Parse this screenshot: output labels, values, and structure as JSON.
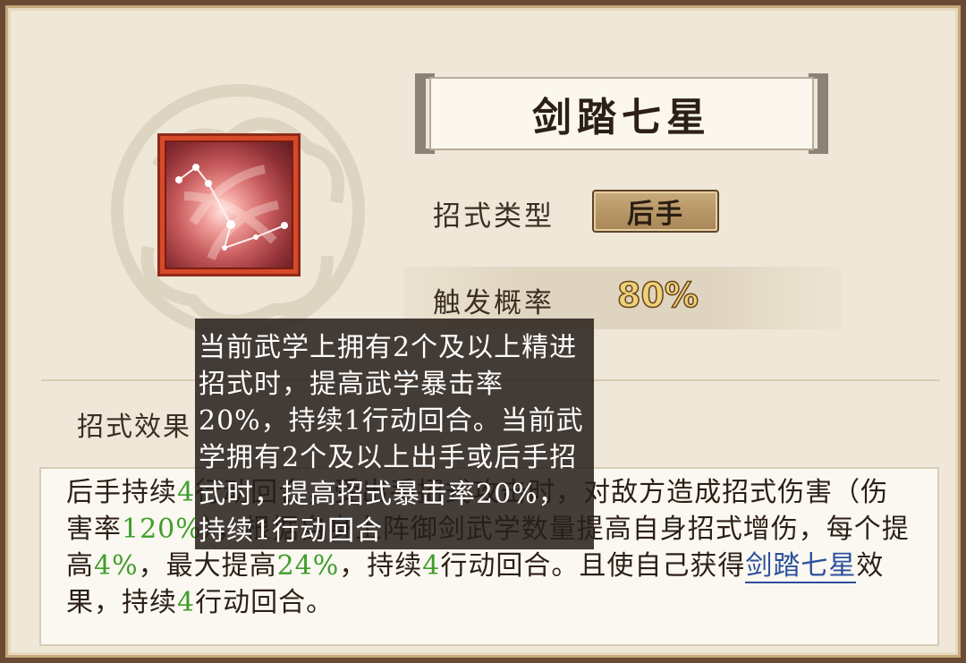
{
  "skill": {
    "name": "剑踏七星",
    "icon": "constellation-skill-icon"
  },
  "attributes": {
    "type_label": "招式类型",
    "type_value": "后手",
    "rate_label": "触发概率",
    "rate_value": "80%"
  },
  "effect": {
    "label": "招式效果",
    "text_parts": [
      "后手持续",
      "4",
      "行动回合，受出手招式攻击时，对敌方造成招式伤害（伤害率",
      "120%",
      "），根据自身上阵御剑武学数量提高自身招式增伤，每个提高",
      "4%",
      "，最大提高",
      "24%",
      "，持续",
      "4",
      "行动回合。且使自己获得",
      "剑踏七星",
      "效果，持续",
      "4",
      "行动回合。"
    ]
  },
  "tooltip": {
    "text": "当前武学上拥有2个及以上精进招式时，提高武学暴击率20%，持续1行动回合。当前武学拥有2个及以上出手或后手招式时，提高招式暴击率20%，持续1行动回合"
  },
  "colors": {
    "highlight_green": "#3f9e2c",
    "link_blue": "#2c4f9e",
    "rate_gold": "#ecd27a",
    "frame_brown": "#6b4a34"
  }
}
